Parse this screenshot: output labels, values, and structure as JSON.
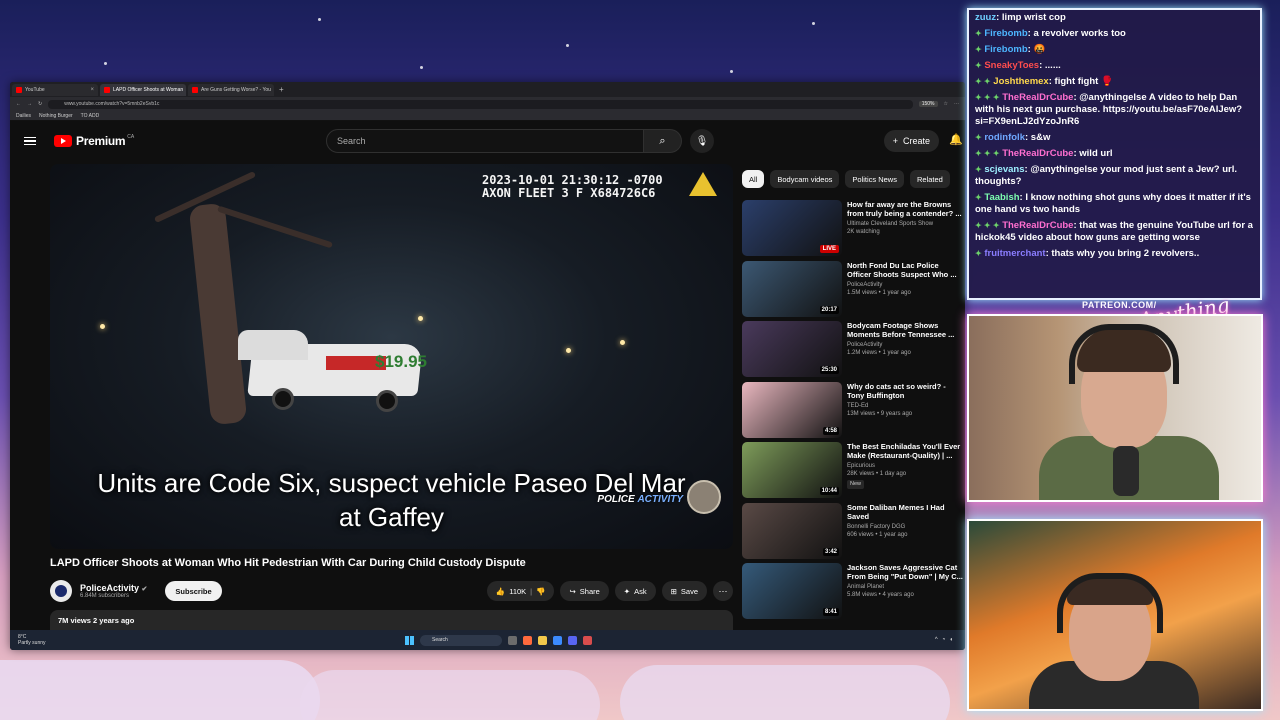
{
  "browser": {
    "tabs": [
      {
        "label": "YouTube",
        "active": false
      },
      {
        "label": "LAPD Officer Shoots at Woman",
        "active": true
      },
      {
        "label": "Are Guns Getting Worse? - You",
        "active": false
      }
    ],
    "new_tab": "+",
    "url": "www.youtube.com/watch?v=5mnb2eSvb1c",
    "zoom": "150%",
    "bookmarks": [
      "Dailies",
      "Nothing Burger",
      "TO ADD"
    ]
  },
  "youtube": {
    "brand": "Premium",
    "country": "CA",
    "search_placeholder": "Search",
    "create_label": "Create",
    "video": {
      "timestamp_line1": "2023-10-01 21:30:12 -0700",
      "timestamp_line2": "AXON FLEET 3 F X684726C6",
      "truck_price": "$19.95",
      "subtitle": "Units are Code Six, suspect vehicle Paseo Del Mar at Gaffey",
      "watermark_a": "POLICE",
      "watermark_b": "ACTIVITY"
    },
    "title": "LAPD Officer Shoots at Woman Who Hit Pedestrian With Car During Child Custody Dispute",
    "channel": {
      "name": "PoliceActivity",
      "subscribers": "6.84M subscribers",
      "verified": "✔"
    },
    "subscribe_label": "Subscribe",
    "likes": "110K",
    "share_label": "Share",
    "ask_label": "Ask",
    "save_label": "Save",
    "views_line": "7M views  2 years ago",
    "chips": [
      "All",
      "Bodycam videos",
      "Politics News",
      "Related"
    ],
    "recommendations": [
      {
        "title": "How far away are the Browns from truly being a contender? ...",
        "channel": "Ultimate Cleveland Sports Show",
        "meta": "2K watching",
        "badge": "LIVE",
        "thumb_color": "#2b3f6b",
        "new": ""
      },
      {
        "title": "North Fond Du Lac Police Officer Shoots Suspect Who ...",
        "channel": "PoliceActivity",
        "meta": "1.5M views • 1 year ago",
        "badge": "20:17",
        "thumb_color": "#3c5873",
        "new": ""
      },
      {
        "title": "Bodycam Footage Shows Moments Before Tennessee ...",
        "channel": "PoliceActivity",
        "meta": "1.2M views • 1 year ago",
        "badge": "25:30",
        "thumb_color": "#4a3a5c",
        "new": ""
      },
      {
        "title": "Why do cats act so weird? - Tony Buffington",
        "channel": "TED-Ed",
        "meta": "13M views • 9 years ago",
        "badge": "4:58",
        "thumb_color": "#e9b7bf",
        "new": ""
      },
      {
        "title": "The Best Enchiladas You'll Ever Make (Restaurant-Quality) | ...",
        "channel": "Epicurious",
        "meta": "28K views • 1 day ago",
        "badge": "10:44",
        "thumb_color": "#7e9c5a",
        "new": "New"
      },
      {
        "title": "Some Daliban Memes I Had Saved",
        "channel": "Bonnelli Factory DGG",
        "meta": "606 views • 1 year ago",
        "badge": "3:42",
        "thumb_color": "#5a4a46",
        "new": ""
      },
      {
        "title": "Jackson Saves Aggressive Cat From Being \"Put Down\" | My C...",
        "channel": "Animal Planet",
        "meta": "5.8M views • 4 years ago",
        "badge": "8:41",
        "thumb_color": "#355a7a",
        "new": ""
      }
    ]
  },
  "taskbar": {
    "temp": "8°C",
    "weather": "Partly sunny",
    "search": "Search"
  },
  "chat": [
    {
      "user": "zuuz",
      "color": "#6fd0ff",
      "badges": "",
      "text": "limp wrist cop"
    },
    {
      "user": "Firebomb",
      "color": "#4db6ff",
      "badges": "✦",
      "text": "a revolver works too"
    },
    {
      "user": "Firebomb",
      "color": "#4db6ff",
      "badges": "✦",
      "text": "🤬"
    },
    {
      "user": "SneakyToes",
      "color": "#ff4d4d",
      "badges": "✦",
      "text": "......"
    },
    {
      "user": "Joshthemex",
      "color": "#ffd84d",
      "badges": "✦ ✦",
      "text": "fight fight 🥊"
    },
    {
      "user": "TheRealDrCube",
      "color": "#ff6fd0",
      "badges": "✦ ✦ ✦",
      "text": "@anythingelse A video to help Dan with his next gun purchase. https://youtu.be/asF70eAlJew?si=FX9enLJ2dYzoJnR6"
    },
    {
      "user": "rodinfolk",
      "color": "#6fa8ff",
      "badges": "✦",
      "text": "s&w"
    },
    {
      "user": "TheRealDrCube",
      "color": "#ff6fd0",
      "badges": "✦ ✦ ✦",
      "text": "wild url"
    },
    {
      "user": "scjevans",
      "color": "#9ef0ff",
      "badges": "✦",
      "text": "@anythingelse your mod just sent a Jew? url. thoughts?"
    },
    {
      "user": "Taabish",
      "color": "#7dffb0",
      "badges": "✦",
      "text": "I know nothing shot guns why does it matter if it's one hand vs two hands"
    },
    {
      "user": "TheRealDrCube",
      "color": "#ff6fd0",
      "badges": "✦ ✦ ✦",
      "text": "that was the genuine YouTube url for a hickok45 video about how guns are getting worse"
    },
    {
      "user": "fruitmerchant",
      "color": "#8a7dff",
      "badges": "✦",
      "text": "thats why you bring 2 revolvers.."
    }
  ],
  "overlay": {
    "patreon": "PATREON.COM/",
    "logo_text": "Anything Else?"
  }
}
